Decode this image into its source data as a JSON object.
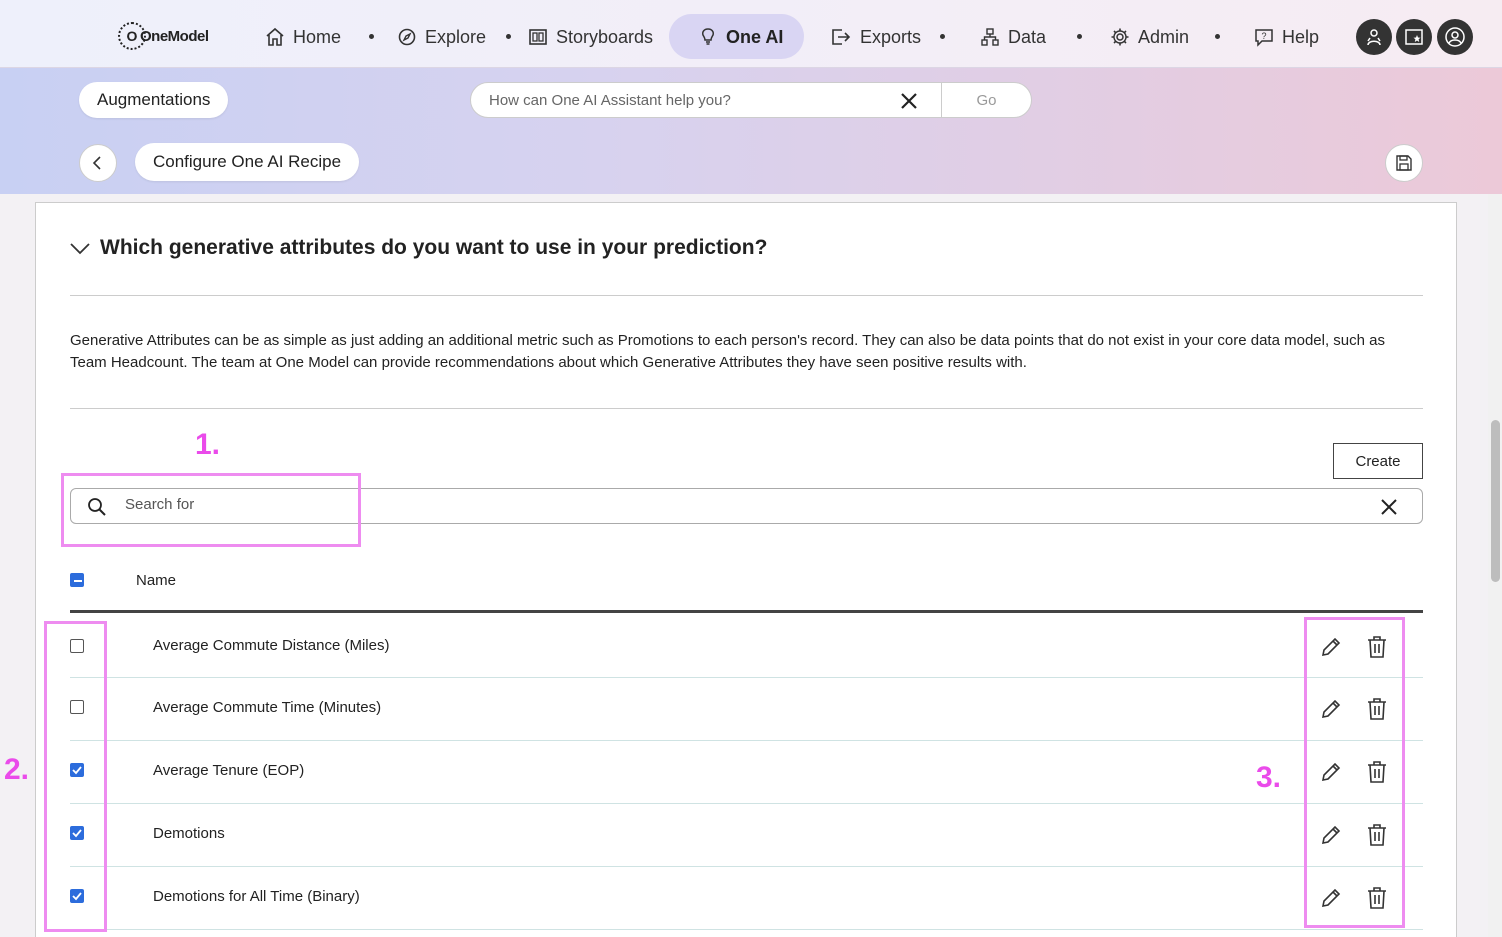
{
  "nav": {
    "logo_text": "OneModel",
    "items": [
      {
        "label": "Home",
        "icon": "home-icon"
      },
      {
        "label": "Explore",
        "icon": "compass-icon"
      },
      {
        "label": "Storyboards",
        "icon": "storyboard-icon"
      },
      {
        "label": "One AI",
        "icon": "lightbulb-icon",
        "active": true
      },
      {
        "label": "Exports",
        "icon": "export-icon"
      },
      {
        "label": "Data",
        "icon": "data-icon"
      },
      {
        "label": "Admin",
        "icon": "gear-icon"
      },
      {
        "label": "Help",
        "icon": "help-icon"
      }
    ]
  },
  "header": {
    "augmentations_label": "Augmentations",
    "assistant_placeholder": "How can One AI Assistant help you?",
    "go_label": "Go",
    "page_title": "Configure One AI Recipe"
  },
  "section": {
    "title": "Which generative attributes do you want to use in your prediction?",
    "description": "Generative Attributes can be as simple as just adding an additional metric such as Promotions to each person's record. They can also be data points that do not exist in your core data model, such as Team Headcount. The team at One Model can provide recommendations about which Generative Attributes they have seen positive results with.",
    "create_label": "Create",
    "search_placeholder": "Search for",
    "name_column": "Name",
    "rows": [
      {
        "name": "Average Commute Distance (Miles)",
        "checked": false
      },
      {
        "name": "Average Commute Time (Minutes)",
        "checked": false
      },
      {
        "name": "Average Tenure (EOP)",
        "checked": true
      },
      {
        "name": "Demotions",
        "checked": true
      },
      {
        "name": "Demotions for All Time (Binary)",
        "checked": true
      }
    ]
  },
  "annotations": {
    "label_1": "1.",
    "label_2": "2.",
    "label_3": "3.",
    "color": "#ea4bea"
  },
  "colors": {
    "accent": "#2c6cdc",
    "active_nav": "#d9d5f3"
  }
}
